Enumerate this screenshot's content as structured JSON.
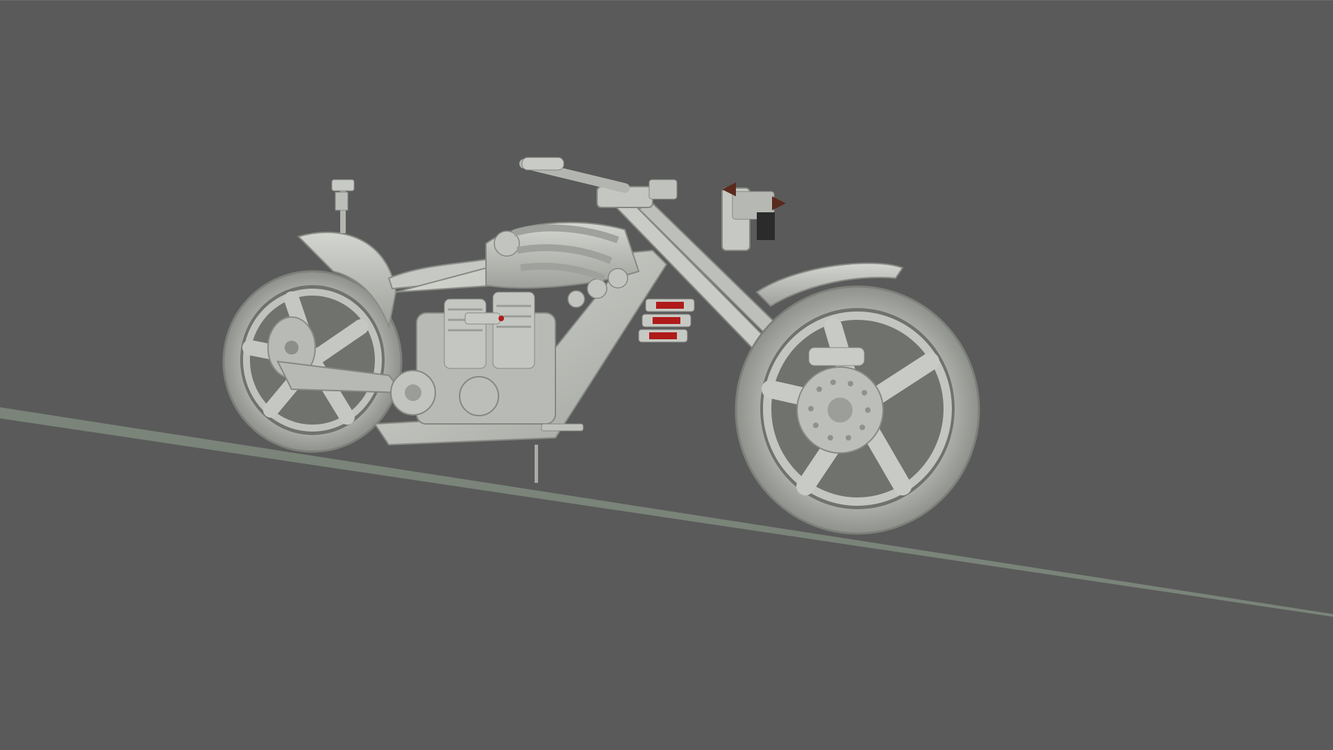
{
  "viewport": {
    "background_color": "#5a5a5a",
    "ground_color": "#7a8479",
    "model_color": "#c3c6c1",
    "accent_red": "#b01a1a",
    "accent_brown": "#5a2a1c",
    "subject": "motorcycle-3d-model"
  }
}
